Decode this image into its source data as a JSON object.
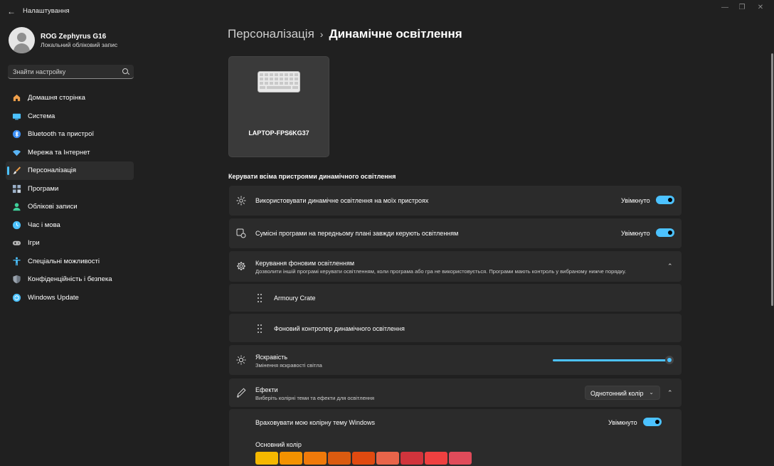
{
  "app": {
    "title": "Налаштування"
  },
  "profile": {
    "name": "ROG Zephyrus G16",
    "account_type": "Локальний обліковий запис"
  },
  "search": {
    "placeholder": "Знайти настройку"
  },
  "sidebar": {
    "items": [
      {
        "label": "Домашня сторінка",
        "icon": "home-icon",
        "color": "#f0a04b"
      },
      {
        "label": "Система",
        "icon": "system-icon",
        "color": "#4cc2ff"
      },
      {
        "label": "Bluetooth та пристрої",
        "icon": "bluetooth-icon",
        "color": "#3b8ff6"
      },
      {
        "label": "Мережа та Інтернет",
        "icon": "wifi-icon",
        "color": "#5ab4f5"
      },
      {
        "label": "Персоналізація",
        "icon": "brush-icon",
        "color": "#f0a04b",
        "active": true
      },
      {
        "label": "Програми",
        "icon": "apps-icon",
        "color": "#9bb0c8"
      },
      {
        "label": "Облікові записи",
        "icon": "accounts-icon",
        "color": "#3fcf9a"
      },
      {
        "label": "Час і мова",
        "icon": "time-language-icon",
        "color": "#4cc2ff"
      },
      {
        "label": "Ігри",
        "icon": "gaming-icon",
        "color": "#b8b8b8"
      },
      {
        "label": "Спеціальні можливості",
        "icon": "accessibility-icon",
        "color": "#4cc2ff"
      },
      {
        "label": "Конфіденційність і безпека",
        "icon": "shield-icon",
        "color": "#9aa3ad"
      },
      {
        "label": "Windows Update",
        "icon": "update-icon",
        "color": "#4cc2ff"
      }
    ]
  },
  "breadcrumb": {
    "parent": "Персоналізація",
    "separator": "›",
    "current": "Динамічне освітлення"
  },
  "device": {
    "name": "LAPTOP-FPS6KG37"
  },
  "section": {
    "title": "Керувати всіма пристроями динамічного освітлення"
  },
  "settings": {
    "use_dynamic": {
      "label": "Використовувати динамічне освітлення на моїх пристроях",
      "state": "Увімкнуто"
    },
    "compatible_apps": {
      "label": "Сумісні програми на передньому плані завжди керують освітленням",
      "state": "Увімкнуто"
    },
    "background": {
      "label": "Керування фоновим освітленням",
      "description": "Дозволити іншій програмі керувати освітленням, коли програма або гра не використовується. Програми мають контроль у вибраному нижче порядку.",
      "apps": [
        "Armoury Crate",
        "Фоновий контролер динамічного освітлення"
      ]
    },
    "brightness": {
      "label": "Яскравість",
      "description": "Змінення яскравості світла",
      "value": 100
    },
    "effects": {
      "label": "Ефекти",
      "description": "Виберіть колірні теми та ефекти для освітлення",
      "selected": "Однотонний колір"
    },
    "match_theme": {
      "label": "Враховувати мою колірну тему Windows",
      "state": "Увімкнуто"
    },
    "main_color": {
      "label": "Основний колір",
      "swatches": [
        "#f5b800",
        "#f39200",
        "#f07a0a",
        "#da5b10",
        "#e04a10",
        "#e8654a",
        "#d1343c",
        "#ef4040",
        "#e04b5a"
      ]
    }
  }
}
